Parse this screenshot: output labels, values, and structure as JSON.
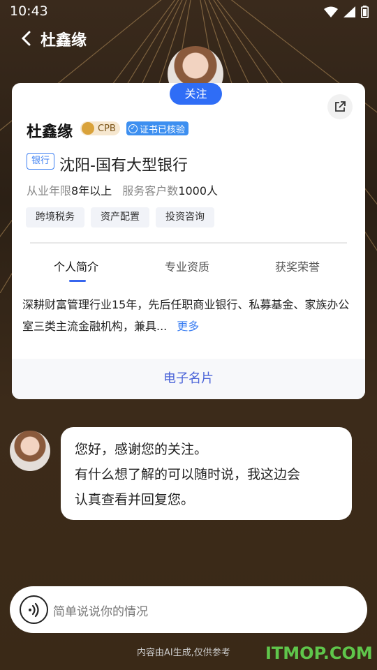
{
  "status_bar": {
    "time": "10:43"
  },
  "header": {
    "title": "杜鑫缘"
  },
  "profile": {
    "follow_label": "关注",
    "name": "杜鑫缘",
    "cpb_badge": "CPB",
    "verified_badge": "证书已核验",
    "bank_tag": "银行",
    "institution": "沈阳-国有大型银行",
    "experience_label": "从业年限",
    "experience_value": "8年以上",
    "clients_label": "服务客户数",
    "clients_value": "1000人",
    "tags": [
      "跨境税务",
      "资产配置",
      "投资咨询"
    ],
    "tabs": [
      "个人简介",
      "专业资质",
      "获奖荣誉"
    ],
    "intro": "深耕财富管理行业15年，先后任职商业银行、私募基金、家族办公室三类主流金融机构，兼具...",
    "more_label": "更多",
    "ecard_label": "电子名片"
  },
  "chat": {
    "message_lines": [
      "您好，感谢您的关注。",
      "有什么想了解的可以随时说，我这边会",
      "认真查看并回复您。"
    ]
  },
  "input": {
    "placeholder": "简单说说你的情况"
  },
  "footer": {
    "disclaimer": "内容由AI生成,仅供参考",
    "watermark": "ITMOP.COM"
  },
  "colors": {
    "accent": "#2f6df6",
    "link": "#3c7ff2",
    "background": "#2b2015"
  }
}
